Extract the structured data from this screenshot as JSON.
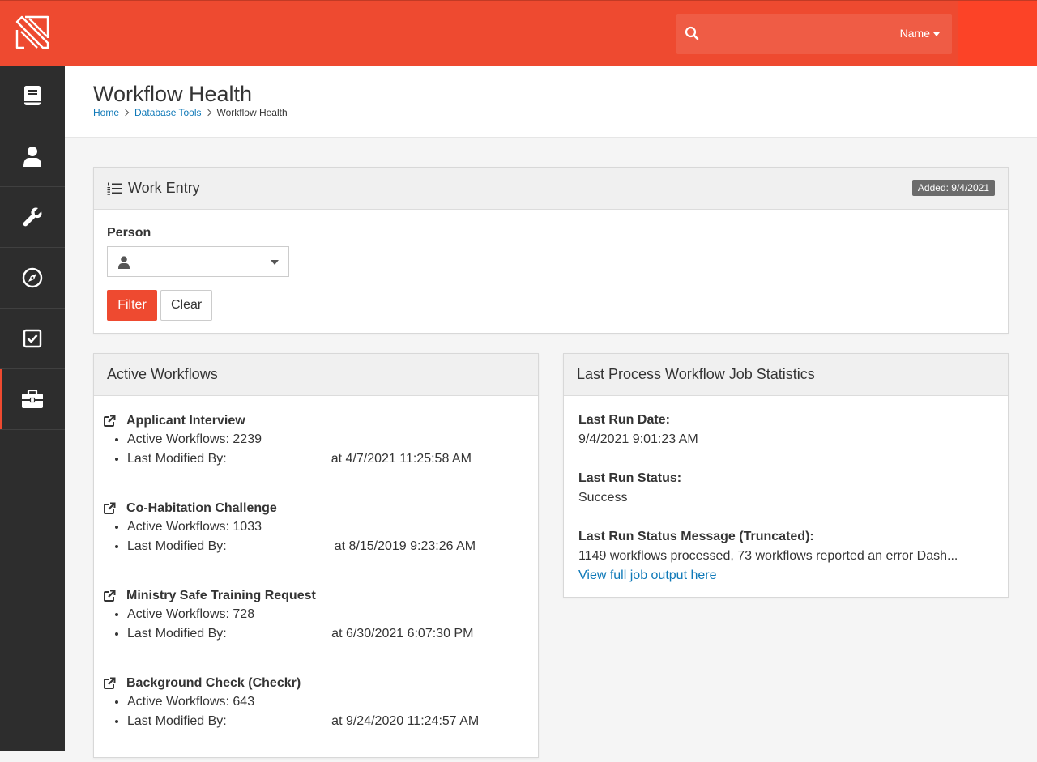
{
  "header": {
    "logo": "rock-logo",
    "search": {
      "placeholder": "",
      "value": ""
    },
    "user_menu_label": "Name",
    "accent_color": "#ee4a30"
  },
  "sidebar": {
    "items": [
      {
        "icon": "book-icon",
        "active": false
      },
      {
        "icon": "person-icon",
        "active": false
      },
      {
        "icon": "wrench-icon",
        "active": false
      },
      {
        "icon": "compass-icon",
        "active": false
      },
      {
        "icon": "checkbox-icon",
        "active": false
      },
      {
        "icon": "briefcase-icon",
        "active": true
      }
    ]
  },
  "page": {
    "title": "Workflow Health",
    "breadcrumb": [
      "Home",
      "Database Tools",
      "Workflow Health"
    ]
  },
  "work_entry": {
    "heading": "Work Entry",
    "added_badge": "Added: 9/4/2021",
    "person_label": "Person",
    "person_value": "",
    "filter_button": "Filter",
    "clear_button": "Clear"
  },
  "active_workflows": {
    "heading": "Active Workflows",
    "items": [
      {
        "name": "Applicant Interview",
        "count_text": "Active Workflows: 2239",
        "modified_label": "Last Modified By:",
        "modified_at": "at 4/7/2021 11:25:58 AM"
      },
      {
        "name": "Co-Habitation Challenge",
        "count_text": "Active Workflows: 1033",
        "modified_label": "Last Modified By:",
        "modified_at": "at 8/15/2019 9:23:26 AM"
      },
      {
        "name": "Ministry Safe Training Request",
        "count_text": "Active Workflows: 728",
        "modified_label": "Last Modified By: ",
        "modified_at": "at 6/30/2021 6:07:30 PM"
      },
      {
        "name": "Background Check (Checkr)",
        "count_text": "Active Workflows: 643",
        "modified_label": "Last Modified By: ",
        "modified_at": "at 9/24/2020 11:24:57 AM"
      }
    ]
  },
  "job_stats": {
    "heading": "Last Process Workflow Job Statistics",
    "last_run_date_label": "Last Run Date:",
    "last_run_date": "9/4/2021 9:01:23 AM",
    "last_run_status_label": "Last Run Status:",
    "last_run_status": "Success",
    "last_run_message_label": "Last Run Status Message (Truncated):",
    "last_run_message": "1149 workflows processed, 73 workflows reported an error Dash...",
    "view_link": "View full job output here"
  }
}
